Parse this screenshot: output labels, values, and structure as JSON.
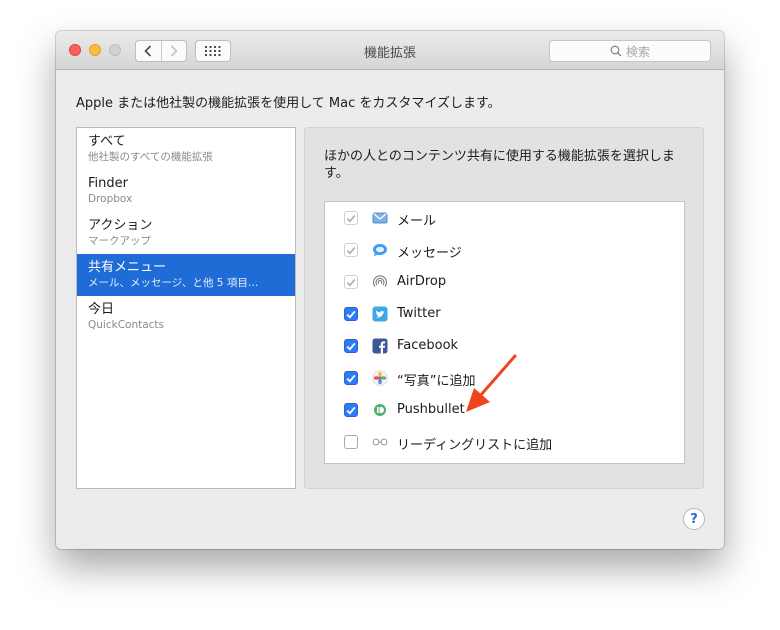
{
  "window": {
    "title": "機能拡張",
    "search_placeholder": "検索"
  },
  "intro": "Apple または他社製の機能拡張を使用して Mac をカスタマイズします。",
  "sidebar": {
    "items": [
      {
        "title": "すべて",
        "subtitle": "他社製のすべての機能拡張",
        "selected": false
      },
      {
        "title": "Finder",
        "subtitle": "Dropbox",
        "selected": false
      },
      {
        "title": "アクション",
        "subtitle": "マークアップ",
        "selected": false
      },
      {
        "title": "共有メニュー",
        "subtitle": "メール、メッセージ、と他 5 項目…",
        "selected": true
      },
      {
        "title": "今日",
        "subtitle": "QuickContacts",
        "selected": false
      }
    ]
  },
  "detail": {
    "description": "ほかの人とのコンテンツ共有に使用する機能拡張を選択します。",
    "extensions": [
      {
        "label": "メール",
        "state": "checked-disabled",
        "icon": "mail-icon"
      },
      {
        "label": "メッセージ",
        "state": "checked-disabled",
        "icon": "messages-icon"
      },
      {
        "label": "AirDrop",
        "state": "checked-disabled",
        "icon": "airdrop-icon"
      },
      {
        "label": "Twitter",
        "state": "checked",
        "icon": "twitter-icon"
      },
      {
        "label": "Facebook",
        "state": "checked",
        "icon": "facebook-icon"
      },
      {
        "label": "“写真”に追加",
        "state": "checked",
        "icon": "photos-icon"
      },
      {
        "label": "Pushbullet",
        "state": "checked",
        "icon": "pushbullet-icon"
      },
      {
        "label": "リーディングリストに追加",
        "state": "unchecked",
        "icon": "reading-list-icon"
      }
    ]
  },
  "help_label": "?",
  "colors": {
    "accent": "#1f6cd6",
    "checkbox_blue": "#2f7bf5",
    "annotation_arrow": "#f0441e"
  }
}
